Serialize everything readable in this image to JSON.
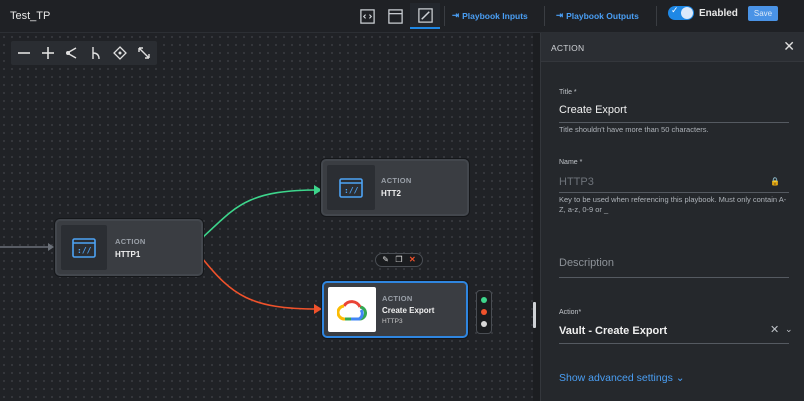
{
  "app": {
    "title": "Test_TP"
  },
  "toolbar": {
    "view_buttons": [
      {
        "icon": "code-view-icon"
      },
      {
        "icon": "window-view-icon"
      },
      {
        "icon": "edit-canvas-icon",
        "active": true
      }
    ],
    "playbook_inputs": "Playbook Inputs",
    "playbook_outputs": "Playbook Outputs",
    "enabled_label": "Enabled",
    "enabled": true,
    "save_label": "Save"
  },
  "canvas": {
    "tools": [
      "zoom-out-icon",
      "zoom-in-icon",
      "connect-icon",
      "branch-icon",
      "center-icon",
      "fit-icon"
    ],
    "nodes": [
      {
        "type_label": "ACTION",
        "name": "HTTP1"
      },
      {
        "type_label": "ACTION",
        "name": "HTT2"
      },
      {
        "type_label": "ACTION",
        "name": "Create Export",
        "subtitle": "HTTP3",
        "selected": true
      }
    ],
    "node_actions": [
      "edit-icon",
      "copy-icon",
      "delete-icon"
    ]
  },
  "panel": {
    "header": "ACTION",
    "title_field": {
      "label": "Title *",
      "value": "Create Export",
      "help": "Title shouldn't have more than 50 characters."
    },
    "name_field": {
      "label": "Name *",
      "placeholder": "HTTP3",
      "help": "Key to be used when referencing this playbook. Must only contain A-Z, a-z, 0-9 or _"
    },
    "description_field": {
      "placeholder": "Description"
    },
    "action_field": {
      "label": "Action*",
      "value": "Vault - Create Export"
    },
    "advanced_link": "Show advanced settings"
  },
  "colors": {
    "accent": "#1f88e5",
    "link": "#4a9ff5",
    "success_wire": "#3dd68c",
    "failure_wire": "#f0522b"
  }
}
